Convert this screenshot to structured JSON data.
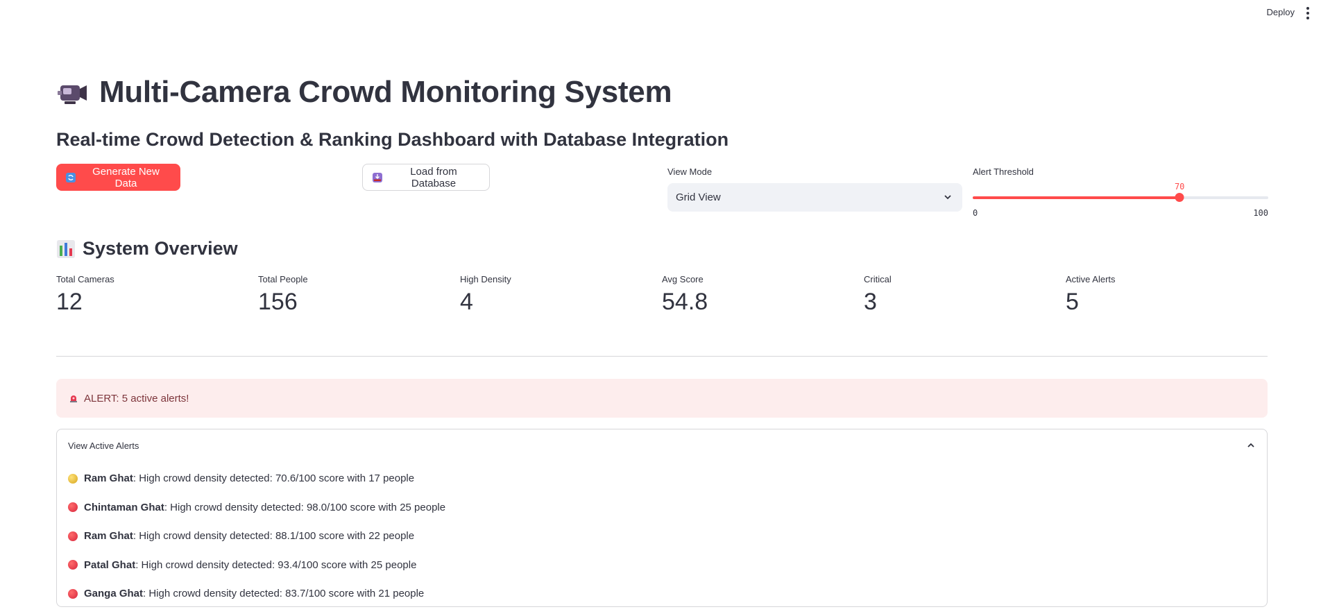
{
  "header": {
    "deploy_label": "Deploy"
  },
  "title": "Multi-Camera Crowd Monitoring System",
  "subtitle": "Real-time Crowd Detection & Ranking Dashboard with Database Integration",
  "controls": {
    "generate_label": "Generate New Data",
    "load_label": "Load from Database",
    "view_mode_label": "View Mode",
    "view_mode_value": "Grid View",
    "threshold_label": "Alert Threshold",
    "threshold_value": "70",
    "threshold_min": "0",
    "threshold_max": "100",
    "threshold_fraction": 0.7
  },
  "overview": {
    "title": "System Overview",
    "metrics": [
      {
        "label": "Total Cameras",
        "value": "12"
      },
      {
        "label": "Total People",
        "value": "156"
      },
      {
        "label": "High Density",
        "value": "4"
      },
      {
        "label": "Avg Score",
        "value": "54.8"
      },
      {
        "label": "Critical",
        "value": "3"
      },
      {
        "label": "Active Alerts",
        "value": "5"
      }
    ]
  },
  "alert_banner": "ALERT: 5 active alerts!",
  "alerts_panel": {
    "header": "View Active Alerts",
    "items": [
      {
        "level": "yellow",
        "name": "Ram Ghat",
        "text": ": High crowd density detected: 70.6/100 score with 17 people"
      },
      {
        "level": "red",
        "name": "Chintaman Ghat",
        "text": ": High crowd density detected: 98.0/100 score with 25 people"
      },
      {
        "level": "red",
        "name": "Ram Ghat",
        "text": ": High crowd density detected: 88.1/100 score with 22 people"
      },
      {
        "level": "red",
        "name": "Patal Ghat",
        "text": ": High crowd density detected: 93.4/100 score with 25 people"
      },
      {
        "level": "red",
        "name": "Ganga Ghat",
        "text": ": High crowd density detected: 83.7/100 score with 21 people"
      }
    ]
  },
  "colors": {
    "primary": "#ff4b4b",
    "alert_bg": "#fdeded",
    "alert_text": "#7d353b"
  },
  "icons": {
    "title": "video-camera-icon",
    "overview": "bar-chart-icon",
    "generate": "refresh-icon",
    "load": "inbox-icon",
    "banner": "siren-icon"
  }
}
